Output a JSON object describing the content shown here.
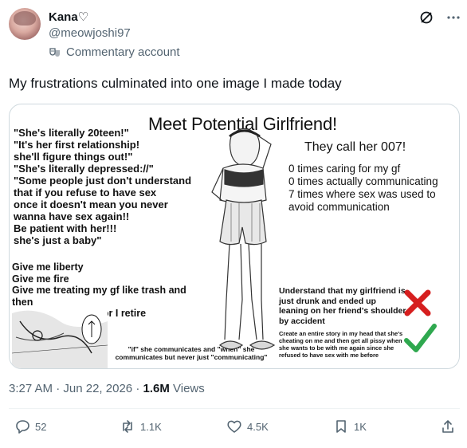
{
  "author": {
    "display_name": "Kana♡",
    "handle": "@meowjoshi97",
    "label": "Commentary account"
  },
  "tweet": {
    "text": "My frustrations culminated into one image I made today",
    "time": "3:27 AM",
    "separator": "·",
    "date": "Jun 22, 2026",
    "views_count": "1.6M",
    "views_label": "Views"
  },
  "image": {
    "title": "Meet Potential Girlfriend!",
    "call": "They call her 007!",
    "stats": [
      "0 times caring for my gf",
      "0 times actually communicating",
      "7 times where sex was used to",
      "avoid communication"
    ],
    "quotes": "\"She's literally 20teen!\"\n\"It's her first relationship!\nshe'll figure things out!\"\n\"She's literally depressed://\"\n\"Some people just don't understand\nthat if you refuse to have sex\nonce it doesn't mean you never\nwanna have sex again!!\nBe patient with her!!!\nshe's just a baby\"",
    "liberty": "Give me liberty\nGive me fire\nGive me treating my gf like trash and then\nacting sad about it or I retire",
    "drunk": "Understand that my girlfriend is just drunk and ended up leaning on her friend's shoulder by accident",
    "story": "Create an entire story in my head that she's cheating on me and then get all pissy when she wants to be with me again since she refused to have sex with me before",
    "ifshe": "\"if\" she communicates and \"when\" she communicates but never just \"communicating\""
  },
  "actions": {
    "replies": "52",
    "reposts": "1.1K",
    "likes": "4.5K",
    "bookmarks": "1K"
  },
  "icons": {
    "commentary": "theater-masks-icon",
    "grok": "grok-icon",
    "more": "more-icon",
    "reply": "reply-icon",
    "repost": "repost-icon",
    "like": "heart-icon",
    "bookmark": "bookmark-icon",
    "share": "share-icon"
  },
  "colors": {
    "text": "#0f1419",
    "secondary": "#536471",
    "border": "#cfd9de",
    "cross": "#d61f1f",
    "check": "#2fa84f"
  }
}
